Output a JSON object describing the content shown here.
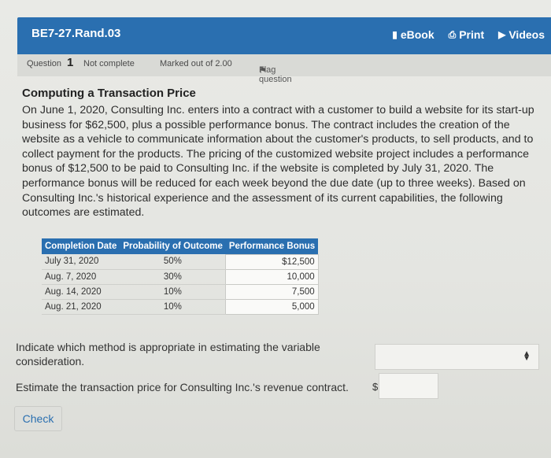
{
  "header": {
    "title": "BE7-27.Rand.03",
    "tools": [
      {
        "label": "eBook",
        "icon": "book-icon"
      },
      {
        "label": "Print",
        "icon": "print-icon"
      },
      {
        "label": "Videos",
        "icon": "play-icon"
      }
    ]
  },
  "status": {
    "question_label": "Question",
    "question_number": "1",
    "completion": "Not complete",
    "marks": "Marked out of 2.00",
    "flag": "Flag question"
  },
  "problem": {
    "heading": "Computing a Transaction Price",
    "paragraph": "On June 1, 2020, Consulting Inc. enters into a contract with a customer to build a website for its start-up business for $62,500, plus a possible performance bonus. The contract includes the creation of the website as a vehicle to communicate information about the customer's products, to sell products, and to collect payment for the products. The pricing of the customized website project includes a performance bonus of $12,500 to be paid to Consulting Inc. if the website is completed by July 31, 2020. The performance bonus will be reduced for each week beyond the due date (up to three weeks). Based on Consulting Inc.'s historical experience and the assessment of its current capabilities, the following outcomes are estimated."
  },
  "table": {
    "headers": [
      "Completion Date",
      "Probability of Outcome",
      "Performance Bonus"
    ],
    "rows": [
      [
        "July 31, 2020",
        "50%",
        "$12,500"
      ],
      [
        "Aug. 7, 2020",
        "30%",
        "10,000"
      ],
      [
        "Aug. 14, 2020",
        "10%",
        "7,500"
      ],
      [
        "Aug. 21, 2020",
        "10%",
        "5,000"
      ]
    ]
  },
  "questions": {
    "method": "Indicate which method is appropriate in estimating the variable consideration.",
    "method_selected": "",
    "price": "Estimate the transaction price for Consulting Inc.'s revenue contract.",
    "currency": "$",
    "price_value": ""
  },
  "actions": {
    "check_label": "Check"
  },
  "colors": {
    "accent": "#2a6fb0"
  }
}
